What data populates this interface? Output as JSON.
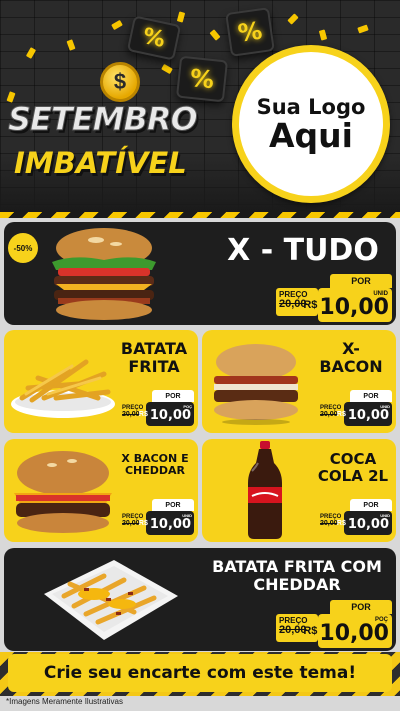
{
  "header": {
    "title_line1": "SETEMBRO",
    "title_line2": "IMBATÍVEL",
    "coin_symbol": "$",
    "percent_symbol": "%",
    "logo_line1": "Sua Logo",
    "logo_line2": "Aqui"
  },
  "colors": {
    "accent": "#f7d21b",
    "dark": "#1e1e1e",
    "background": "#d8d8d8"
  },
  "icons": [
    "dollar-coin-icon",
    "percent-cube-icon"
  ],
  "products": {
    "xtudo": {
      "name": "X - TUDO",
      "badge": "-50%",
      "por_label": "POR",
      "old_label": "PREÇO",
      "old_value": "20,00",
      "currency": "R$",
      "price": "10,00",
      "unit": "UNID"
    },
    "batata": {
      "name_line1": "BATATA",
      "name_line2": "FRITA",
      "por_label": "POR",
      "old_label": "PREÇO",
      "old_value": "20,00",
      "currency": "R$",
      "price": "10,00",
      "unit": "POÇ"
    },
    "xbacon": {
      "name_line1": "X-",
      "name_line2": "BACON",
      "por_label": "POR",
      "old_label": "PREÇO",
      "old_value": "20,00",
      "currency": "R$",
      "price": "10,00",
      "unit": "UNID"
    },
    "xbaconcheddar": {
      "name_line1": "X BACON E",
      "name_line2": "CHEDDAR",
      "por_label": "POR",
      "old_label": "PREÇO",
      "old_value": "20,00",
      "currency": "R$",
      "price": "10,00",
      "unit": "UNID"
    },
    "coca": {
      "name_line1": "COCA",
      "name_line2": "COLA 2L",
      "por_label": "POR",
      "old_label": "PREÇO",
      "old_value": "20,00",
      "currency": "R$",
      "price": "10,00",
      "unit": "UNID"
    },
    "batatacheddar": {
      "name_line1": "BATATA FRITA COM",
      "name_line2": "CHEDDAR",
      "por_label": "POR",
      "old_label": "PREÇO",
      "old_value": "20,00",
      "currency": "R$",
      "price": "10,00",
      "unit": "POÇ"
    }
  },
  "footer": {
    "cta": "Crie seu encarte com este tema!",
    "disclaimer": "*Imagens Meramente Ilustrativas"
  }
}
